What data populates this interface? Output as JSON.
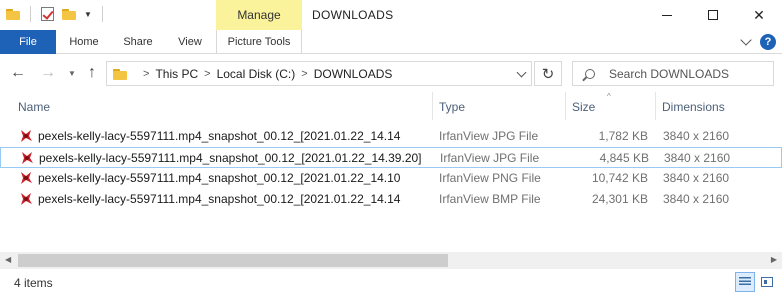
{
  "titlebar": {
    "title": "DOWNLOADS",
    "manage_tab": "Manage"
  },
  "ribbon": {
    "tabs": [
      "File",
      "Home",
      "Share",
      "View",
      "Picture Tools"
    ]
  },
  "address": {
    "crumbs": [
      "This PC",
      "Local Disk (C:)",
      "DOWNLOADS"
    ],
    "search_placeholder": "Search DOWNLOADS"
  },
  "columns": {
    "name": "Name",
    "type": "Type",
    "size": "Size",
    "dimensions": "Dimensions"
  },
  "files": [
    {
      "name": "pexels-kelly-lacy-5597111.mp4_snapshot_00.12_[2021.01.22_14.14",
      "type": "IrfanView JPG File",
      "size": "1,782 KB",
      "dimensions": "3840 x 2160"
    },
    {
      "name": "pexels-kelly-lacy-5597111.mp4_snapshot_00.12_[2021.01.22_14.39.20]",
      "type": "IrfanView JPG File",
      "size": "4,845 KB",
      "dimensions": "3840 x 2160"
    },
    {
      "name": "pexels-kelly-lacy-5597111.mp4_snapshot_00.12_[2021.01.22_14.10",
      "type": "IrfanView PNG File",
      "size": "10,742 KB",
      "dimensions": "3840 x 2160"
    },
    {
      "name": "pexels-kelly-lacy-5597111.mp4_snapshot_00.12_[2021.01.22_14.14",
      "type": "IrfanView BMP File",
      "size": "24,301 KB",
      "dimensions": "3840 x 2160"
    }
  ],
  "status": {
    "item_count": "4 items"
  },
  "icons": {
    "file_icon": "irfanview-icon",
    "accent": "#1e62b8",
    "manage_bg": "#fbf39c"
  }
}
